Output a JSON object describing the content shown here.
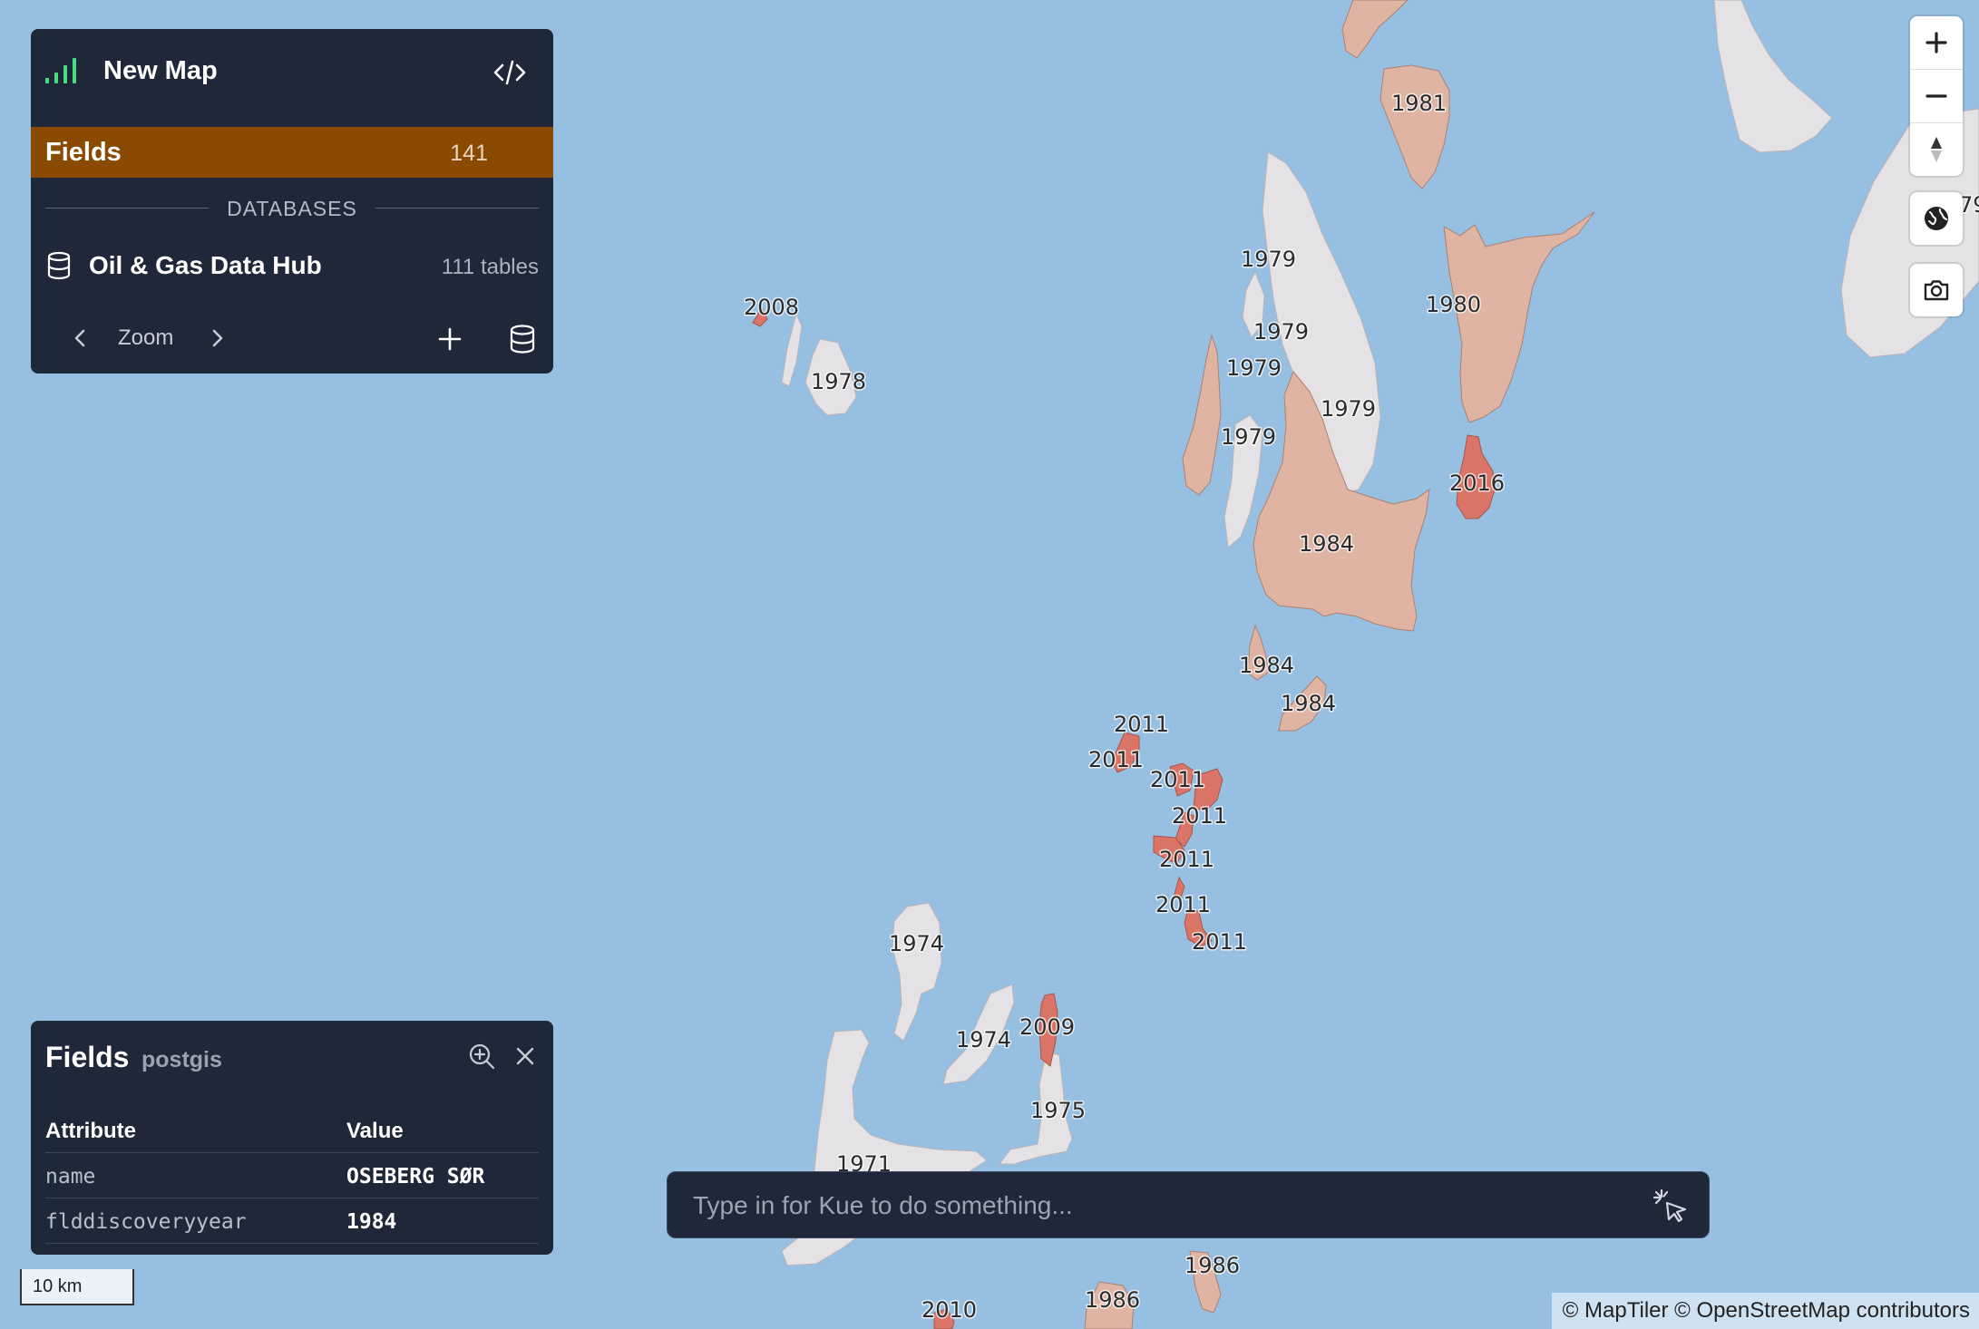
{
  "map": {
    "labels": [
      "1981",
      "1979",
      "1979",
      "1979",
      "1979",
      "1979",
      "1980",
      "2016",
      "1984",
      "1984",
      "1984",
      "2008",
      "1978",
      "2011",
      "2011",
      "2011",
      "2011",
      "2011",
      "2011",
      "2011",
      "1974",
      "1974",
      "2009",
      "1975",
      "1971",
      "1986",
      "1986",
      "2010",
      "79"
    ]
  },
  "colors": {
    "water": "#96bfe2",
    "field_old": "#e0b4a3",
    "field_new": "#da7466",
    "field_gas": "#e4e2e4"
  },
  "top_panel": {
    "title": "New Map",
    "layer_name": "Fields",
    "layer_count": "141",
    "section_label": "DATABASES",
    "database_name": "Oil & Gas Data Hub",
    "database_tables": "111 tables",
    "zoom_label": "Zoom"
  },
  "attribute_panel": {
    "title": "Fields",
    "subtitle": "postgis",
    "columns": [
      "Attribute",
      "Value"
    ],
    "rows": [
      {
        "attribute": "name",
        "value": "OSEBERG SØR"
      },
      {
        "attribute": "flddiscoveryyear",
        "value": "1984"
      }
    ]
  },
  "kue": {
    "placeholder": "Type in for Kue to do something..."
  },
  "scale": {
    "label": "10 km"
  },
  "attribution": "© MapTiler © OpenStreetMap contributors",
  "icons": [
    "signal-icon",
    "code-icon",
    "database-icon",
    "chevron-left-icon",
    "chevron-right-icon",
    "plus-icon",
    "database-icon",
    "zoom-to-icon",
    "close-icon",
    "cursor-sparkle-icon",
    "zoom-in-icon",
    "zoom-out-icon",
    "compass-icon",
    "globe-icon",
    "camera-icon"
  ]
}
